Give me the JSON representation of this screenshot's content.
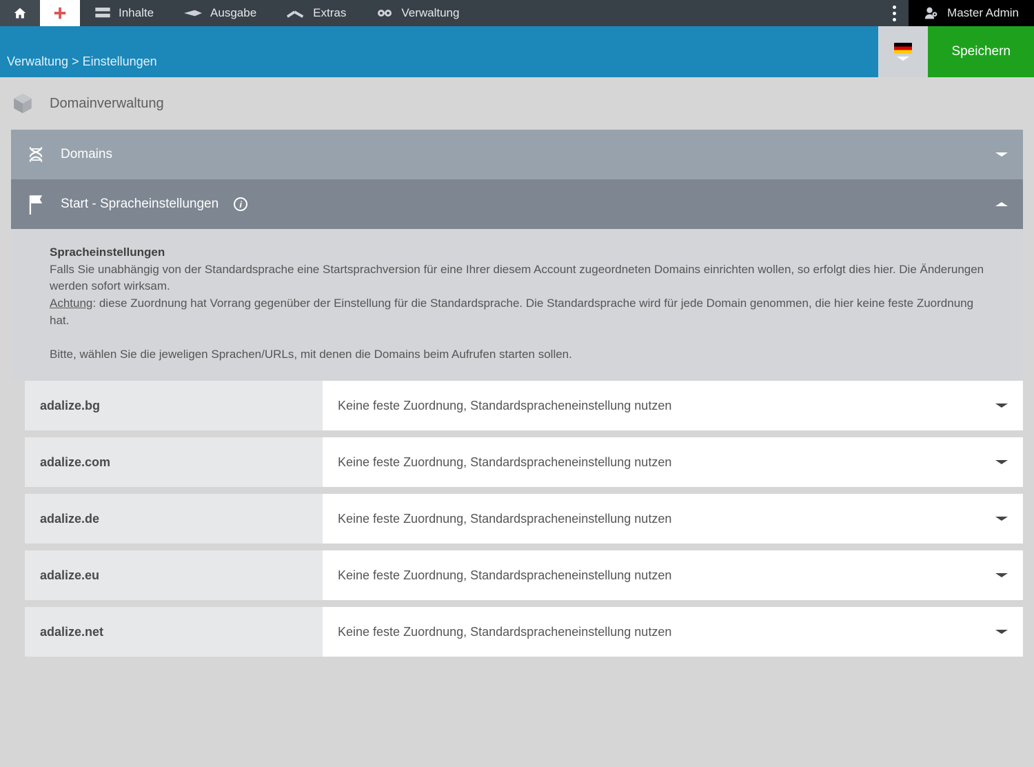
{
  "topnav": {
    "items": [
      {
        "label": "Inhalte"
      },
      {
        "label": "Ausgabe"
      },
      {
        "label": "Extras"
      },
      {
        "label": "Verwaltung"
      }
    ],
    "admin_label": "Master Admin"
  },
  "subheader": {
    "breadcrumb": "Verwaltung > Einstellungen",
    "save_label": "Speichern"
  },
  "page": {
    "title": "Domainverwaltung",
    "groups": {
      "domains": {
        "title": "Domains"
      },
      "lang": {
        "title": "Start - Spracheinstellungen",
        "heading": "Spracheinstellungen",
        "p1": "Falls Sie unabhängig von der Standardsprache eine Startsprachversion für eine Ihrer diesem Account zugeordneten Domains einrichten wollen, so erfolgt dies hier. Die Änderungen werden sofort wirksam.",
        "p2_u": "Achtung",
        "p2_rest": ": diese Zuordnung hat Vorrang gegenüber der Einstellung für die Standardsprache. Die Standardsprache wird für jede Domain genommen, die hier keine feste Zuordnung hat.",
        "p3": "Bitte, wählen Sie die jeweligen Sprachen/URLs, mit denen die Domains beim Aufrufen starten sollen."
      }
    },
    "default_option": "Keine feste Zuordnung, Standardspracheneinstellung nutzen",
    "rows": [
      {
        "domain": "adalize.bg"
      },
      {
        "domain": "adalize.com"
      },
      {
        "domain": "adalize.de"
      },
      {
        "domain": "adalize.eu"
      },
      {
        "domain": "adalize.net"
      }
    ]
  }
}
